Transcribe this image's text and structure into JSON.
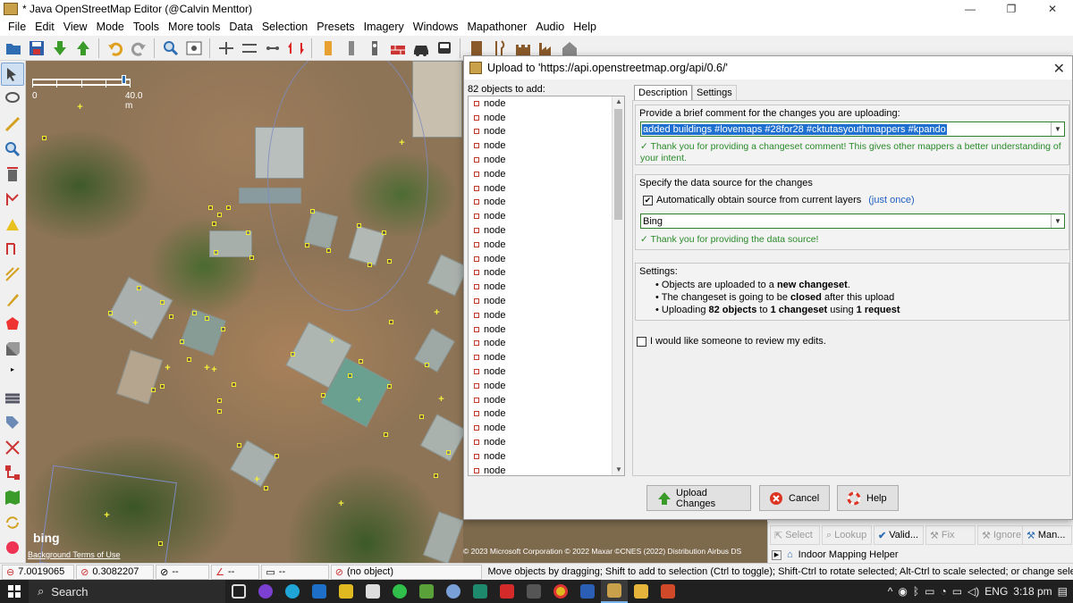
{
  "window": {
    "title": "* Java OpenStreetMap Editor (@Calvin Menttor)",
    "controls": [
      "—",
      "❐",
      "✕"
    ]
  },
  "menu": [
    "File",
    "Edit",
    "View",
    "Mode",
    "Tools",
    "More tools",
    "Data",
    "Selection",
    "Presets",
    "Imagery",
    "Windows",
    "Mapathoner",
    "Audio",
    "Help"
  ],
  "map": {
    "scale_zero": "0",
    "scale_label": "40.0 m",
    "bing": "bing",
    "background_terms": "Background Terms of Use",
    "copyright": "© 2023 Microsoft Corporation © 2022 Maxar ©CNES (2022) Distribution Airbus DS"
  },
  "dialog": {
    "title": "Upload to 'https://api.openstreetmap.org/api/0.6/'",
    "close": "✕",
    "objects_header": "82 objects to add:",
    "node_label": "node",
    "tabs": [
      "Description",
      "Settings"
    ],
    "comment_prompt": "Provide a brief comment for the changes you are uploading:",
    "comment_value": "added buildings #lovemaps #28for28 #cktutasyouthmappers #kpando",
    "comment_ok": "✓ Thank you for providing a changeset comment! This gives other mappers a better understanding of your intent.",
    "source_prompt": "Specify the data source for the changes",
    "auto_source_label": "Automatically obtain source from current layers",
    "just_once": "(just once)",
    "source_value": "Bing",
    "source_ok": "✓ Thank you for providing the data source!",
    "settings_label": "Settings:",
    "settings_items": [
      {
        "pre": "Objects are uploaded to a ",
        "bold": "new changeset",
        "post": ".",
        "b2": "",
        "post2": "",
        "b3": "",
        "post3": ""
      },
      {
        "pre": "The changeset is going to be ",
        "bold": "closed",
        "post": " after this upload",
        "b2": "",
        "post2": "",
        "b3": "",
        "post3": ""
      },
      {
        "pre": "Uploading ",
        "bold": "82 objects",
        "post": " to ",
        "b2": "1 changeset",
        "post2": " using ",
        "b3": "1 request",
        "post3": ""
      }
    ],
    "review_label": "I would like someone to review my edits.",
    "buttons": {
      "upload": "Upload Changes",
      "cancel": "Cancel",
      "help": "Help"
    }
  },
  "toggle_dialog": {
    "buttons": [
      "Select",
      "Lookup",
      "Valid...",
      "Fix",
      "Ignore",
      "Man..."
    ],
    "indoor": "Indoor Mapping Helper"
  },
  "status": {
    "lat": "7.0019065",
    "lon": "0.3082207",
    "heading": "--",
    "angle": "--",
    "distance": "--",
    "selection": "(no object)",
    "help": "Move objects by dragging; Shift to add to selection (Ctrl to toggle); Shift-Ctrl to rotate selected; Alt-Ctrl to scale selected; or change selection"
  },
  "taskbar": {
    "search": "Search",
    "lang": "ENG",
    "time": "3:18 pm",
    "tray_up": "^"
  },
  "colors": {
    "ok_green": "#2a8a2a",
    "selection_blue": "#1f6fd0",
    "node_yellow": "#f2ee2b",
    "taskbar": "#202020"
  }
}
